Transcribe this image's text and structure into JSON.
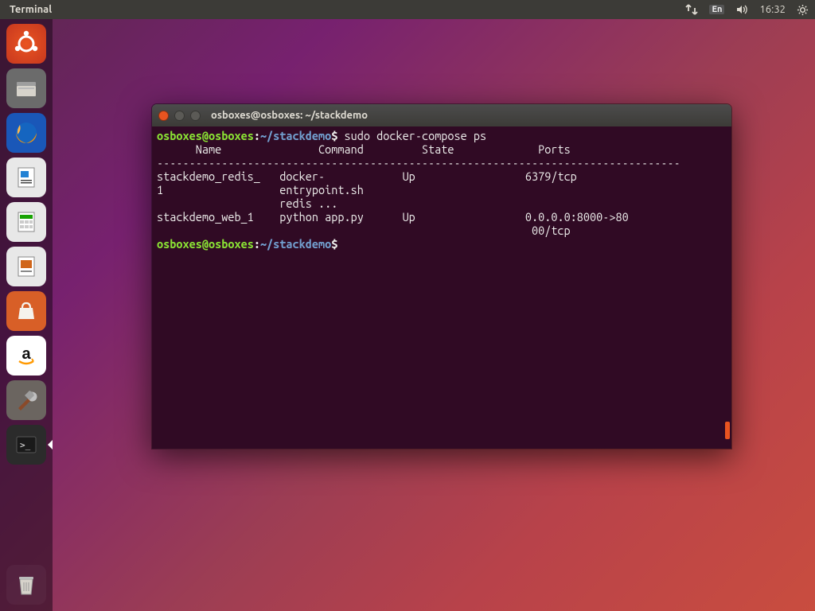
{
  "top_panel": {
    "active_app": "Terminal",
    "language": "En",
    "clock": "16:32"
  },
  "launcher": {
    "items": [
      {
        "id": "dash",
        "name": "ubuntu-dash"
      },
      {
        "id": "files",
        "name": "files"
      },
      {
        "id": "firefox",
        "name": "firefox"
      },
      {
        "id": "writer",
        "name": "libreoffice-writer"
      },
      {
        "id": "calc",
        "name": "libreoffice-calc"
      },
      {
        "id": "impress",
        "name": "libreoffice-impress"
      },
      {
        "id": "software",
        "name": "ubuntu-software"
      },
      {
        "id": "amazon",
        "name": "amazon"
      },
      {
        "id": "settings",
        "name": "system-settings"
      },
      {
        "id": "terminal",
        "name": "terminal",
        "active": true
      },
      {
        "id": "trash",
        "name": "trash"
      }
    ]
  },
  "terminal": {
    "title": "osboxes@osboxes: ~/stackdemo",
    "prompt": {
      "user": "osboxes",
      "at": "@",
      "host": "osboxes",
      "colon": ":",
      "path": "~/stackdemo",
      "dollar": "$"
    },
    "command": " sudo docker-compose ps",
    "output": {
      "headers": {
        "name": "      Name          ",
        "command": "     Command       ",
        "state": "  State   ",
        "ports": "          Ports         "
      },
      "divider": "---------------------------------------------------------------------------------",
      "rows": [
        {
          "name": "stackdemo_redis_   ",
          "command": "docker-            ",
          "state": "Up        ",
          "ports": "         6379/tcp                ",
          "cont": [
            "1                  entrypoint.sh                                              ",
            "                   redis ...                                                  "
          ]
        },
        {
          "name": "stackdemo_web_1    ",
          "command": "python app.py      ",
          "state": "Up        ",
          "ports": "         0.0.0.0:8000->80       ",
          "cont": [
            "                                                          00/tcp                "
          ]
        }
      ]
    }
  }
}
